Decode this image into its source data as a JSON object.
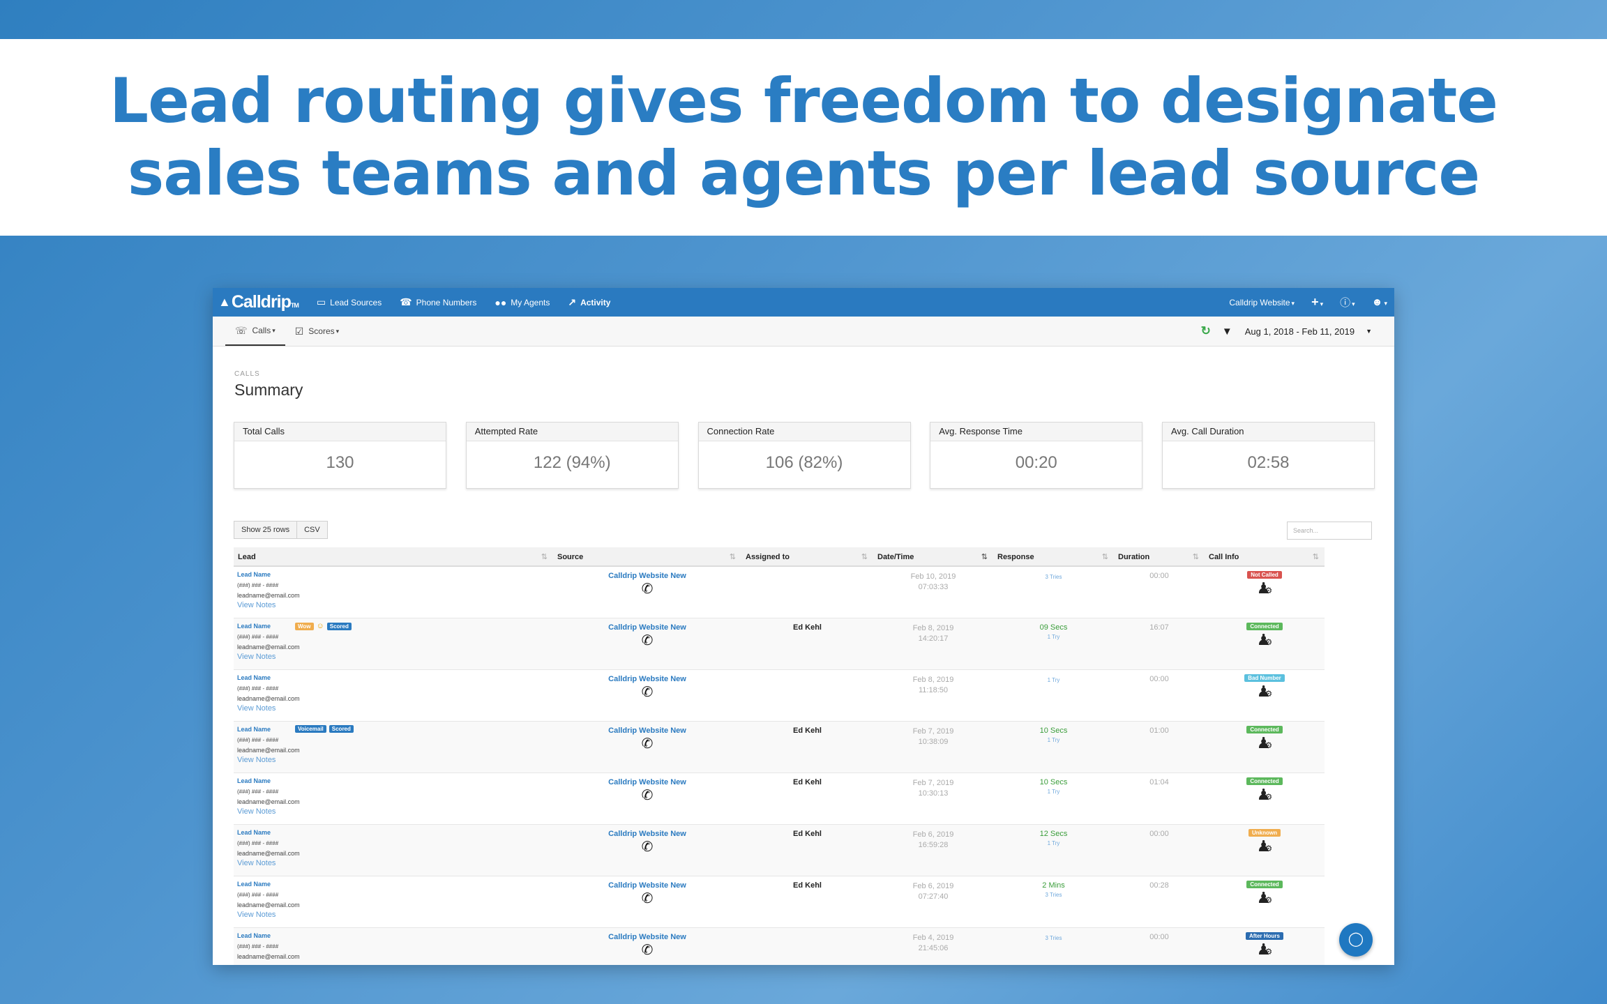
{
  "headline": {
    "line1": "Lead routing gives freedom to designate",
    "line2": "sales teams and agents per lead source"
  },
  "topnav": {
    "logo": "Calldrip",
    "logo_tm": "TM",
    "items": [
      {
        "label": "Lead Sources",
        "icon": "monitor-icon"
      },
      {
        "label": "Phone Numbers",
        "icon": "phone-icon"
      },
      {
        "label": "My Agents",
        "icon": "users-icon"
      },
      {
        "label": "Activity",
        "icon": "chart-icon"
      }
    ],
    "account": "Calldrip Website"
  },
  "subnav": {
    "calls": "Calls",
    "scores": "Scores",
    "date_range": "Aug 1, 2018 - Feb 11, 2019"
  },
  "summary": {
    "kicker": "CALLS",
    "title": "Summary",
    "cards": [
      {
        "label": "Total Calls",
        "value": "130"
      },
      {
        "label": "Attempted Rate",
        "value": "122 (94%)"
      },
      {
        "label": "Connection Rate",
        "value": "106 (82%)"
      },
      {
        "label": "Avg. Response Time",
        "value": "00:20"
      },
      {
        "label": "Avg. Call Duration",
        "value": "02:58"
      }
    ]
  },
  "controls": {
    "show_rows": "Show 25 rows",
    "csv": "CSV",
    "search_placeholder": "Search..."
  },
  "table": {
    "columns": [
      "Lead",
      "Source",
      "Assigned to",
      "Date/Time",
      "Response",
      "Duration",
      "Call Info"
    ],
    "rows": [
      {
        "name": "Lead Name",
        "phone": "(###) ### - ####",
        "email": "leadname@email.com",
        "notes": "View Notes",
        "tags": [],
        "source": "Calldrip Website New",
        "assigned": "",
        "date": "Feb 10, 2019",
        "time": "07:03:33",
        "response": "",
        "response_sub": "3 Tries",
        "duration": "00:00",
        "status": "Not Called",
        "status_color": "#d9534f"
      },
      {
        "name": "Lead Name",
        "phone": "(###) ### - ####",
        "email": "leadname@email.com",
        "notes": "View Notes",
        "tags": [
          "Wow",
          "Scored"
        ],
        "emoji": true,
        "source": "Calldrip Website New",
        "assigned": "Ed Kehl",
        "date": "Feb 8, 2019",
        "time": "14:20:17",
        "response": "09 Secs",
        "response_sub": "1 Try",
        "duration": "16:07",
        "status": "Connected",
        "status_color": "#5cb85c"
      },
      {
        "name": "Lead Name",
        "phone": "(###) ### - ####",
        "email": "leadname@email.com",
        "notes": "View Notes",
        "tags": [],
        "source": "Calldrip Website New",
        "assigned": "",
        "date": "Feb 8, 2019",
        "time": "11:18:50",
        "response": "",
        "response_sub": "1 Try",
        "duration": "00:00",
        "status": "Bad Number",
        "status_color": "#5bc0de"
      },
      {
        "name": "Lead Name",
        "phone": "(###) ### - ####",
        "email": "leadname@email.com",
        "notes": "View Notes",
        "tags": [
          "Voicemail",
          "Scored"
        ],
        "source": "Calldrip Website New",
        "assigned": "Ed Kehl",
        "date": "Feb 7, 2019",
        "time": "10:38:09",
        "response": "10 Secs",
        "response_sub": "1 Try",
        "duration": "01:00",
        "status": "Connected",
        "status_color": "#5cb85c"
      },
      {
        "name": "Lead Name",
        "phone": "(###) ### - ####",
        "email": "leadname@email.com",
        "notes": "View Notes",
        "tags": [],
        "source": "Calldrip Website New",
        "assigned": "Ed Kehl",
        "date": "Feb 7, 2019",
        "time": "10:30:13",
        "response": "10 Secs",
        "response_sub": "1 Try",
        "duration": "01:04",
        "status": "Connected",
        "status_color": "#5cb85c"
      },
      {
        "name": "Lead Name",
        "phone": "(###) ### - ####",
        "email": "leadname@email.com",
        "notes": "View Notes",
        "tags": [],
        "source": "Calldrip Website New",
        "assigned": "Ed Kehl",
        "date": "Feb 6, 2019",
        "time": "16:59:28",
        "response": "12 Secs",
        "response_sub": "1 Try",
        "duration": "00:00",
        "status": "Unknown",
        "status_color": "#f0ad4e"
      },
      {
        "name": "Lead Name",
        "phone": "(###) ### - ####",
        "email": "leadname@email.com",
        "notes": "View Notes",
        "tags": [],
        "source": "Calldrip Website New",
        "assigned": "Ed Kehl",
        "date": "Feb 6, 2019",
        "time": "07:27:40",
        "response": "2 Mins",
        "response_sub": "3 Tries",
        "duration": "00:28",
        "status": "Connected",
        "status_color": "#5cb85c"
      },
      {
        "name": "Lead Name",
        "phone": "(###) ### - ####",
        "email": "leadname@email.com",
        "notes": "",
        "tags": [],
        "source": "Calldrip Website New",
        "assigned": "",
        "date": "Feb 4, 2019",
        "time": "21:45:06",
        "response": "",
        "response_sub": "3 Tries",
        "duration": "00:00",
        "status": "After Hours",
        "status_color": "#2b6cb0"
      }
    ]
  }
}
